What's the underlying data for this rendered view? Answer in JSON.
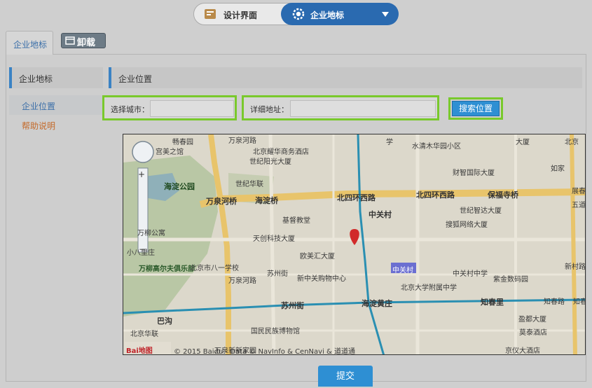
{
  "switcher": {
    "left_label": "设计界面",
    "right_label": "企业地标"
  },
  "tabs": {
    "active_label": "企业地标",
    "unload_label": "卸载"
  },
  "sidebar": {
    "heading": "企业地标",
    "items": [
      {
        "label": "企业位置"
      },
      {
        "label": "帮助说明"
      }
    ]
  },
  "main": {
    "heading": "企业位置",
    "city_label": "选择城市：",
    "city_value": "",
    "address_label": "详细地址：",
    "address_value": "",
    "search_label": "搜索位置",
    "submit_label": "提交"
  },
  "map": {
    "labels": {
      "park": "海淀公园",
      "road_north4": "北四环西路",
      "road_north4b": "北四环西路",
      "road_wanquan_bridge": "万泉河桥",
      "road_haidian_bridge": "海淀桥",
      "road_wanquanhe_v": "万泉河路",
      "road_wanquanhe_v2": "万泉河路",
      "road_suzhoujie": "苏州街",
      "road_suzhoujie_v": "苏州街",
      "road_haidianhuangzhuang": "海淀黄庄",
      "road_zhichunli": "知春里",
      "road_baogosi": "保福寺桥",
      "road_xincun": "新村路",
      "station_zhongguancun": "中关村",
      "station_bagou": "巴沟",
      "district_zhongguancun": "中关村",
      "poi_gongyuan": "世纪阳光大厦",
      "poi_wanliu": "万柳高尔夫俱乐部",
      "poi_jidu": "基督教堂",
      "poi_tianchuang": "天创科技大厦",
      "poi_oumei": "欧美汇大厦",
      "poi_xinzhongguan": "新中关购物中心",
      "poi_beijingbayi": "北京市八一学校",
      "poi_huaxing": "北京耀华商务酒店",
      "poi_shijihuanlian": "世纪华联",
      "poi_changchunyuan": "水清木华园小区",
      "poi_caizhi": "财智国际大厦",
      "poi_shiji": "世纪智达大厦",
      "poi_souhu": "搜狐网络大厦",
      "poi_zhongguancun_middle": "中关村中学",
      "poi_zijinshuma": "紫金数码园",
      "poi_renda": "北京大学附属中学",
      "poi_beijinghuayuan": "北京华联",
      "poi_guomin": "国民民族博物馆",
      "poi_moliu": "莫泰酒店",
      "poi_yingfu": "盈都大厦",
      "poi_jingyi": "京仪大酒店",
      "poi_gongyuan2": "宫美之馆",
      "poi_changchun": "畅春园",
      "poi_xiaoba": "小八里庄",
      "poi_xiaofang": "万泉新新家园",
      "poi_zhichun2": "知春",
      "poi_zhichunroad": "知春路",
      "poi_daxue": "学",
      "poi_dasha": "大厦",
      "poi_wanliugong": "万柳公寓",
      "poi_ruguo": "如家",
      "poi_north": "北京",
      "poi_zhanchun": "展春",
      "poi_wudao": "五道",
      "copyright": "© 2015 Baidu - Data © NavInfo & CenNavi & 道道通",
      "brand": "Bai地图"
    },
    "zoom_plus": "+",
    "zoom_minus": "−"
  }
}
